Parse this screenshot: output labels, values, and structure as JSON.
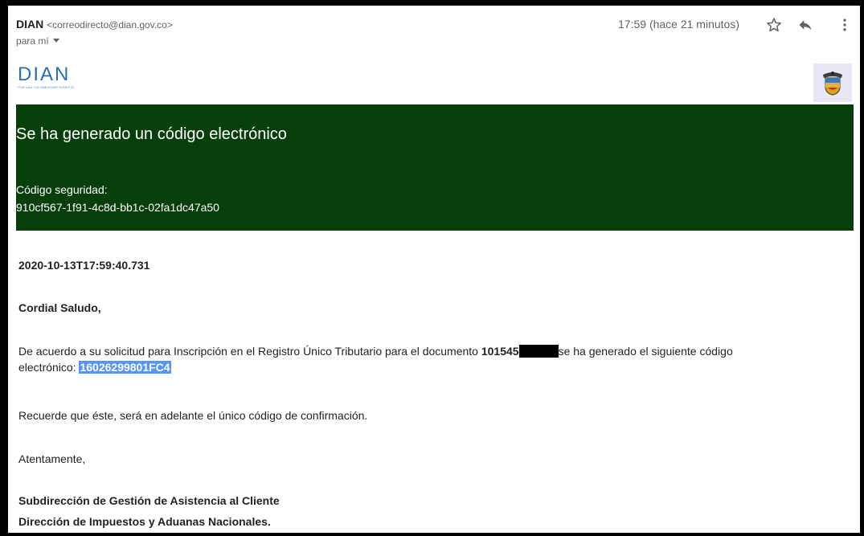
{
  "email": {
    "sender_name": "DIAN",
    "sender_email": "<correodirecto@dian.gov.co>",
    "recipient": "para mí",
    "time": "17:59 (hace 21 minutos)",
    "icons": {
      "star": "star-icon",
      "reply": "reply-icon",
      "more": "more-vert-icon"
    }
  },
  "brand": {
    "logo_text": "DIAN",
    "logo_tagline": "POR UNA COLOMBIA MÁS HONESTA",
    "logo_color": "#2a6fb0",
    "banner_color": "#073f0a"
  },
  "banner": {
    "title": "Se ha generado un código electrónico",
    "code_label": "Código seguridad:",
    "code_value": "910cf567-1f91-4c8d-bb1c-02fa1dc47a50"
  },
  "body": {
    "timestamp": "2020-10-13T17:59:40.731",
    "greeting": "Cordial Saludo,",
    "paragraph_before_doc": "De acuerdo a su solicitud para Inscripción en el Registro Único Tributario para el documento ",
    "document_number": "101545",
    "paragraph_after_doc": "se ha generado el siguiente código",
    "paragraph_line2": "electrónico: ",
    "electronic_code": "16026299801FC4",
    "reminder": "Recuerde que éste, será en adelante el único código de confirmación.",
    "closing": "Atentamente,",
    "signature_line1": "Subdirección de Gestión de Asistencia al Cliente",
    "signature_line2": "Dirección de Impuestos y Aduanas Nacionales."
  }
}
